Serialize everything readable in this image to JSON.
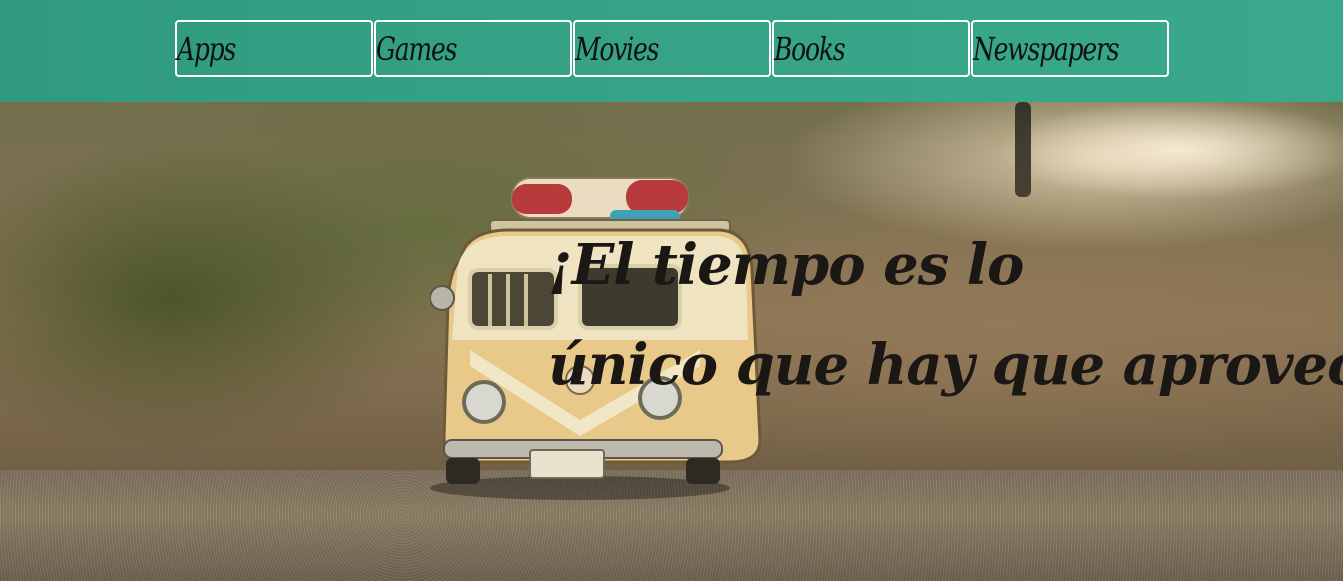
{
  "nav": {
    "items": [
      {
        "label": "Apps"
      },
      {
        "label": "Games"
      },
      {
        "label": "Movies"
      },
      {
        "label": "Books"
      },
      {
        "label": "Newspapers"
      }
    ]
  },
  "hero": {
    "headline_line1": "¡El tiempo es lo",
    "headline_line2": "único que hay que aprovechar!"
  },
  "colors": {
    "navbar": "#35a285",
    "nav_border": "#ffffff",
    "headline_text": "#1a1714"
  }
}
